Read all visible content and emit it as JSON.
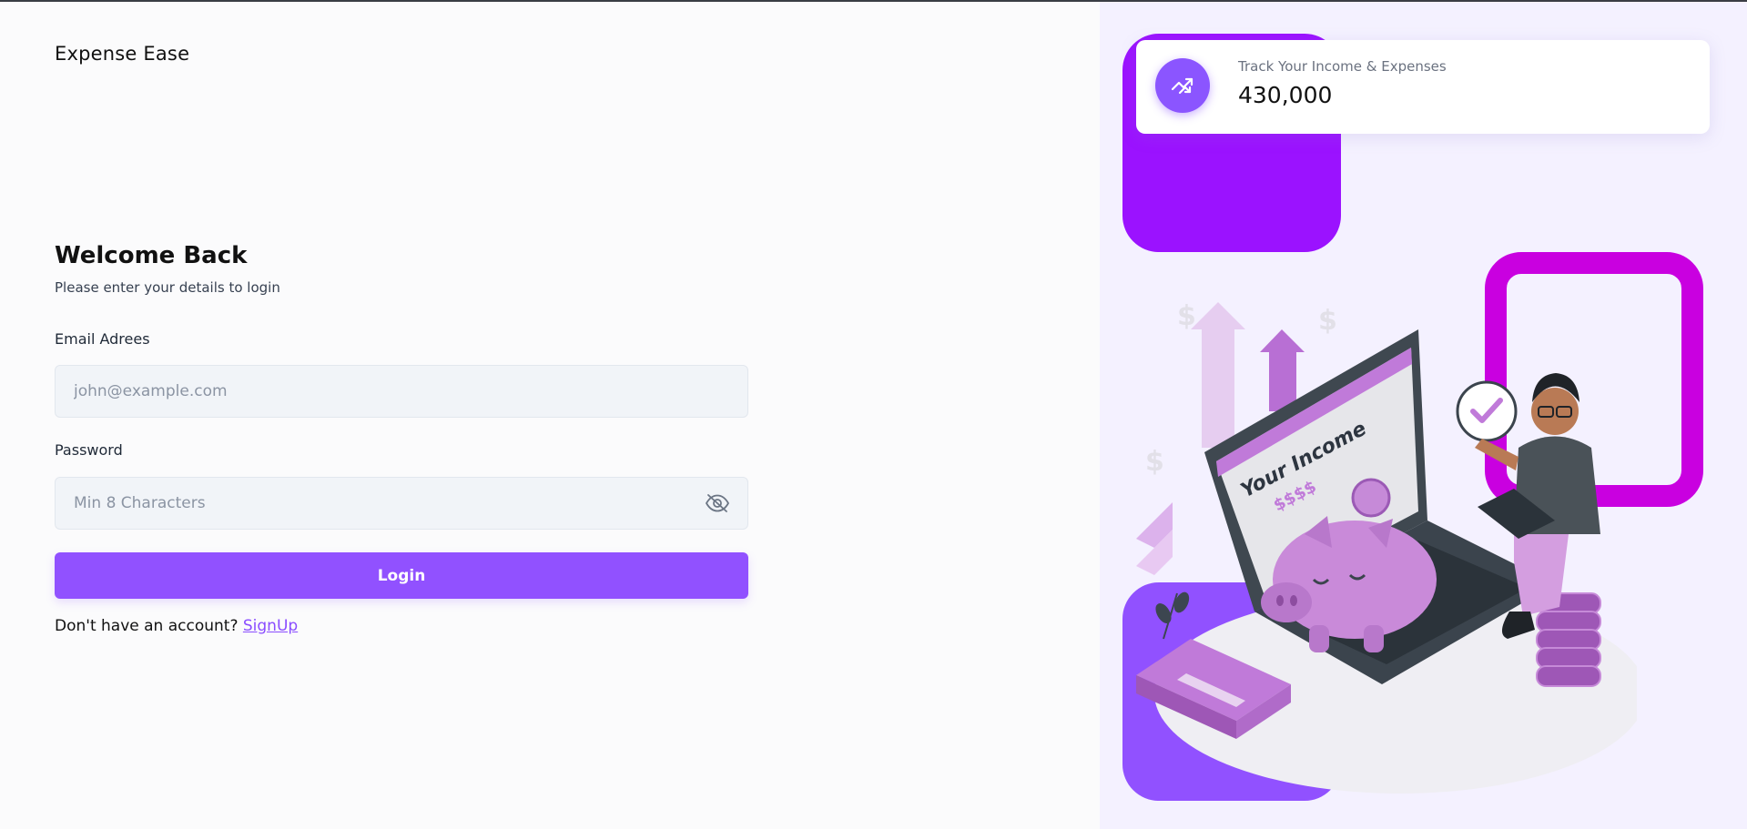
{
  "app": {
    "brand": "Expense Ease"
  },
  "login": {
    "title": "Welcome Back",
    "subtitle": "Please enter your details to login",
    "email_label": "Email Adrees",
    "email_placeholder": "john@example.com",
    "password_label": "Password",
    "password_placeholder": "Min 8 Characters",
    "password_toggle_icon": "eye-off-icon",
    "login_button": "Login",
    "signup_prompt": "Don't have an account?",
    "signup_link": "SignUp"
  },
  "stat_card": {
    "icon": "trend-arrows-icon",
    "label": "Track Your Income & Expenses",
    "value": "430,000"
  },
  "illustration": {
    "screen_title": "Your Income",
    "screen_value": "$$$$"
  },
  "colors": {
    "accent": "#9151ff",
    "purple_block": "#9b12ff",
    "magenta_frame": "#c900e0",
    "right_bg": "#f4f1ff"
  }
}
